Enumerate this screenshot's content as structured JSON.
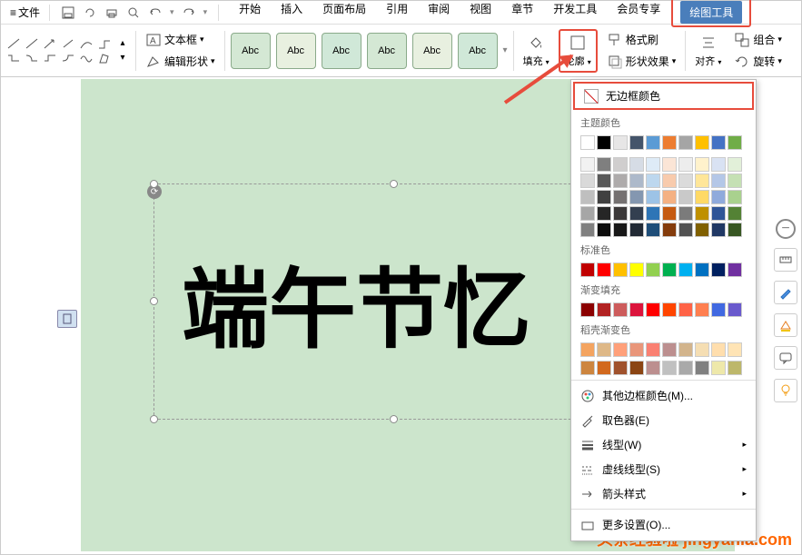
{
  "titlebar": {
    "menu_label": "文件"
  },
  "tabs": {
    "start": "开始",
    "insert": "插入",
    "layout": "页面布局",
    "ref": "引用",
    "review": "审阅",
    "view": "视图",
    "chapter": "章节",
    "dev": "开发工具",
    "member": "会员专享",
    "drawing": "绘图工具"
  },
  "ribbon": {
    "textbox_label": "文本框",
    "editshape_label": "编辑形状",
    "abc": "Abc",
    "fill_label": "填充",
    "outline_label": "轮廓",
    "formatpainter": "格式刷",
    "shapeeffect": "形状效果",
    "align": "对齐",
    "group": "组合",
    "rotate": "旋转"
  },
  "canvas": {
    "text": "端午节忆"
  },
  "dropdown": {
    "no_border": "无边框颜色",
    "theme_colors": "主题颜色",
    "standard_colors": "标准色",
    "gradient_fill": "渐变填充",
    "docer_gradient": "稻壳渐变色",
    "more_colors": "其他边框颜色(M)...",
    "eyedropper": "取色器(E)",
    "line_type": "线型(W)",
    "dash_type": "虚线线型(S)",
    "arrow_style": "箭头样式",
    "more_settings": "更多设置(O)..."
  },
  "colors": {
    "theme_row1": [
      "#ffffff",
      "#000000",
      "#e7e6e6",
      "#44546a",
      "#5b9bd5",
      "#ed7d31",
      "#a5a5a5",
      "#ffc000",
      "#4472c4",
      "#70ad47"
    ],
    "theme_shades": [
      [
        "#f2f2f2",
        "#7f7f7f",
        "#d0cece",
        "#d6dce5",
        "#deebf7",
        "#fbe5d6",
        "#ededed",
        "#fff2cc",
        "#d9e2f3",
        "#e2f0d9"
      ],
      [
        "#d9d9d9",
        "#595959",
        "#aeabab",
        "#adb9ca",
        "#bdd7ee",
        "#f8cbad",
        "#dbdbdb",
        "#ffe699",
        "#b4c7e7",
        "#c5e0b4"
      ],
      [
        "#bfbfbf",
        "#404040",
        "#757171",
        "#8497b0",
        "#9dc3e6",
        "#f4b183",
        "#c9c9c9",
        "#ffd966",
        "#8faadc",
        "#a9d18e"
      ],
      [
        "#a6a6a6",
        "#262626",
        "#3b3838",
        "#333f50",
        "#2e75b6",
        "#c55a11",
        "#7b7b7b",
        "#bf9000",
        "#2f5597",
        "#548235"
      ],
      [
        "#808080",
        "#0d0d0d",
        "#171717",
        "#222a35",
        "#1f4e79",
        "#843c0c",
        "#525252",
        "#806000",
        "#203864",
        "#385723"
      ]
    ],
    "standard": [
      "#c00000",
      "#ff0000",
      "#ffc000",
      "#ffff00",
      "#92d050",
      "#00b050",
      "#00b0f0",
      "#0070c0",
      "#002060",
      "#7030a0"
    ],
    "gradient": [
      "#8b0000",
      "#b22222",
      "#cd5c5c",
      "#dc143c",
      "#ff0000",
      "#ff4500",
      "#ff6347",
      "#ff7f50",
      "#4169e1",
      "#6a5acd"
    ],
    "docer1": [
      "#f4a460",
      "#deb887",
      "#ffa07a",
      "#e9967a",
      "#fa8072",
      "#bc8f8f",
      "#d2b48c",
      "#f5deb3",
      "#ffdead",
      "#ffe4b5"
    ],
    "docer2": [
      "#cd853f",
      "#d2691e",
      "#a0522d",
      "#8b4513",
      "#bc8f8f",
      "#c0c0c0",
      "#a9a9a9",
      "#808080",
      "#eee8aa",
      "#bdb76b"
    ]
  },
  "watermark": "头条经验啦 jingyanla.com"
}
